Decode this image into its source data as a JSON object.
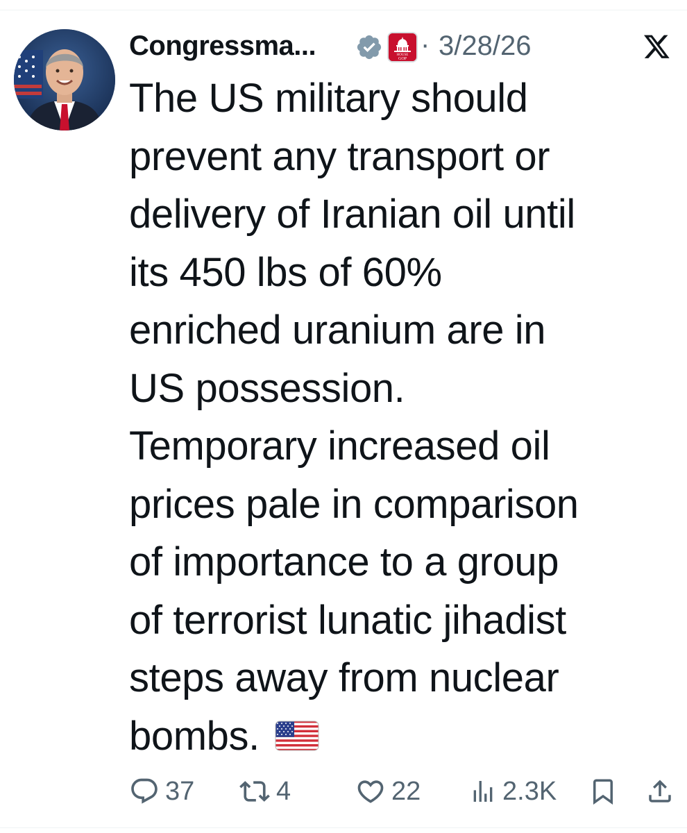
{
  "author": {
    "display_name": "Congressma...",
    "verified_icon": "verified-badge-icon",
    "affiliate_badge": {
      "icon": "house-gop-badge-icon",
      "text_top": "HOUSE",
      "text_bottom": "GOP"
    }
  },
  "post": {
    "separator": "·",
    "date": "3/28/26",
    "text": "The US military should\nprevent any transport or\ndelivery of Iranian oil until\nits 450 lbs of 60%\nenriched uranium are in\nUS possession.\nTemporary increased oil\nprices pale in comparison\nof importance to a group\nof terrorist lunatic jihadist\nsteps away from nuclear\nbombs.",
    "emoji": "us-flag"
  },
  "platform": {
    "logo_icon": "x-logo-icon"
  },
  "actions": {
    "replies": "37",
    "reposts": "4",
    "likes": "22",
    "views": "2.3K",
    "bookmark_icon": "bookmark-icon",
    "share_icon": "share-icon"
  },
  "colors": {
    "text": "#0f1419",
    "secondary": "#536471",
    "verified": "#829aab",
    "gop_red": "#c8102e",
    "divider": "#eff3f4"
  }
}
